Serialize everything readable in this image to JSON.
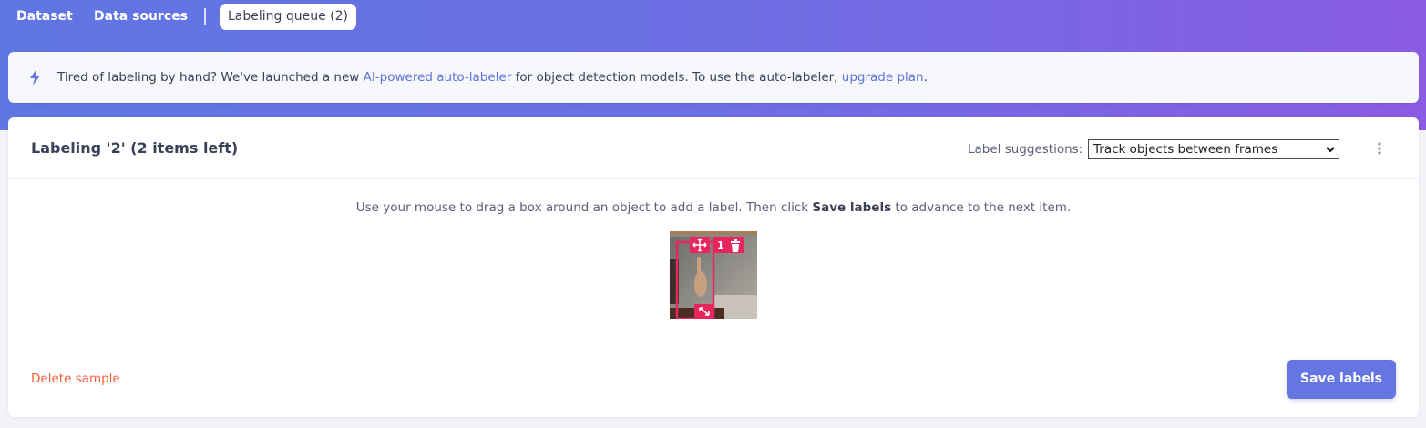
{
  "nav": {
    "tabs": [
      {
        "label": "Dataset"
      },
      {
        "label": "Data sources"
      },
      {
        "label": "Labeling queue (2)"
      }
    ]
  },
  "banner": {
    "icon": "lightning-icon",
    "text_1": "Tired of labeling by hand? We've launched a new ",
    "link_1": "AI-powered auto-labeler",
    "text_2": " for object detection models. To use the auto-labeler, ",
    "link_2": "upgrade plan",
    "text_3": "."
  },
  "panel": {
    "title": "Labeling '2' (2 items left)",
    "suggestions_label": "Label suggestions:",
    "suggestions_value": "Track objects between frames",
    "instructions_1": "Use your mouse to drag a box around an object to add a label. Then click ",
    "instructions_bold": "Save labels",
    "instructions_2": " to advance to the next item.",
    "bounding_box": {
      "label": "1"
    },
    "delete_label": "Delete sample",
    "save_label": "Save labels"
  },
  "colors": {
    "accent": "#6576e3",
    "link": "#5f73dd",
    "danger": "#f0603a",
    "box": "#e8265e"
  }
}
